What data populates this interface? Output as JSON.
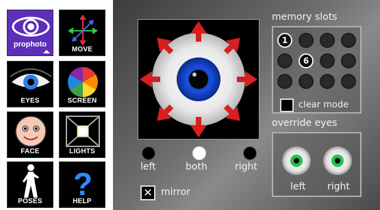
{
  "palette": {
    "prophoto": {
      "pro": "pro",
      "photo": "photo"
    },
    "move": "MOVE",
    "eyes": "EYES",
    "screen": "SCREEN",
    "face": "FACE",
    "lights": "LIGHTS",
    "poses": "POSES",
    "help": "HELP"
  },
  "eye_target": {
    "options": [
      {
        "label": "left",
        "selected": false
      },
      {
        "label": "both",
        "selected": true
      },
      {
        "label": "right",
        "selected": false
      }
    ],
    "mirror_label": "mirror",
    "mirror_checked": true,
    "mirror_mark": "✕"
  },
  "memory": {
    "title": "memory slots",
    "slot_1": "1",
    "slot_6": "6",
    "clear_label": "clear mode",
    "clear_checked": false
  },
  "override": {
    "title": "override eyes",
    "left_label": "left",
    "right_label": "right"
  },
  "colors": {
    "iris": "#1a4fe0",
    "arrows": "#d81f1f",
    "override_iris": "#22c24a",
    "prophoto_bg": "#5b2fb8"
  }
}
